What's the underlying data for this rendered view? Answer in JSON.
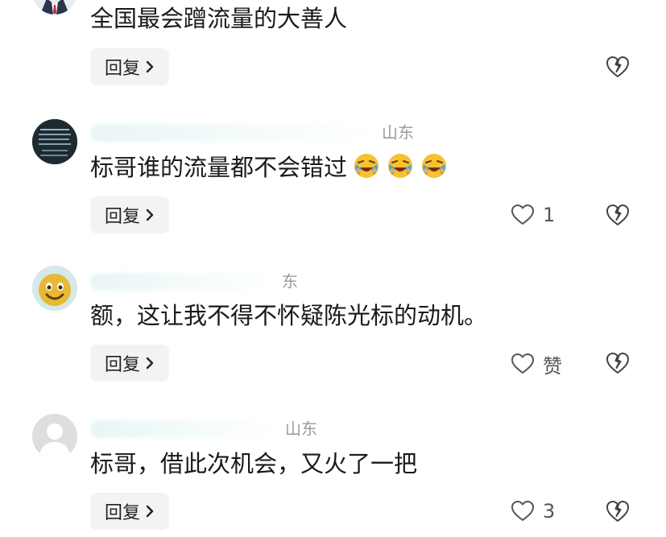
{
  "comments": [
    {
      "location": "",
      "text": "全国最会蹭流量的大善人",
      "reply_label": "回复",
      "like_label": "",
      "emojis": []
    },
    {
      "location": "山东",
      "text": "标哥谁的流量都不会错过",
      "reply_label": "回复",
      "like_label": "1",
      "emojis": [
        "laughing-crying-emoji",
        "laughing-crying-emoji",
        "laughing-crying-emoji"
      ]
    },
    {
      "location": "东",
      "text": "额，这让我不得不怀疑陈光标的动机。",
      "reply_label": "回复",
      "like_label": "赞",
      "emojis": []
    },
    {
      "location": "山东",
      "text": "标哥，借此次机会，又火了一把",
      "reply_label": "回复",
      "like_label": "3",
      "emojis": []
    }
  ],
  "icons": {
    "reply_chevron": "chevron-right-icon",
    "like": "heart-outline-icon",
    "dislike": "broken-heart-icon"
  },
  "colors": {
    "text": "#1a1a1a",
    "muted": "#9a9a9a",
    "button_bg": "#f3f3f3"
  }
}
